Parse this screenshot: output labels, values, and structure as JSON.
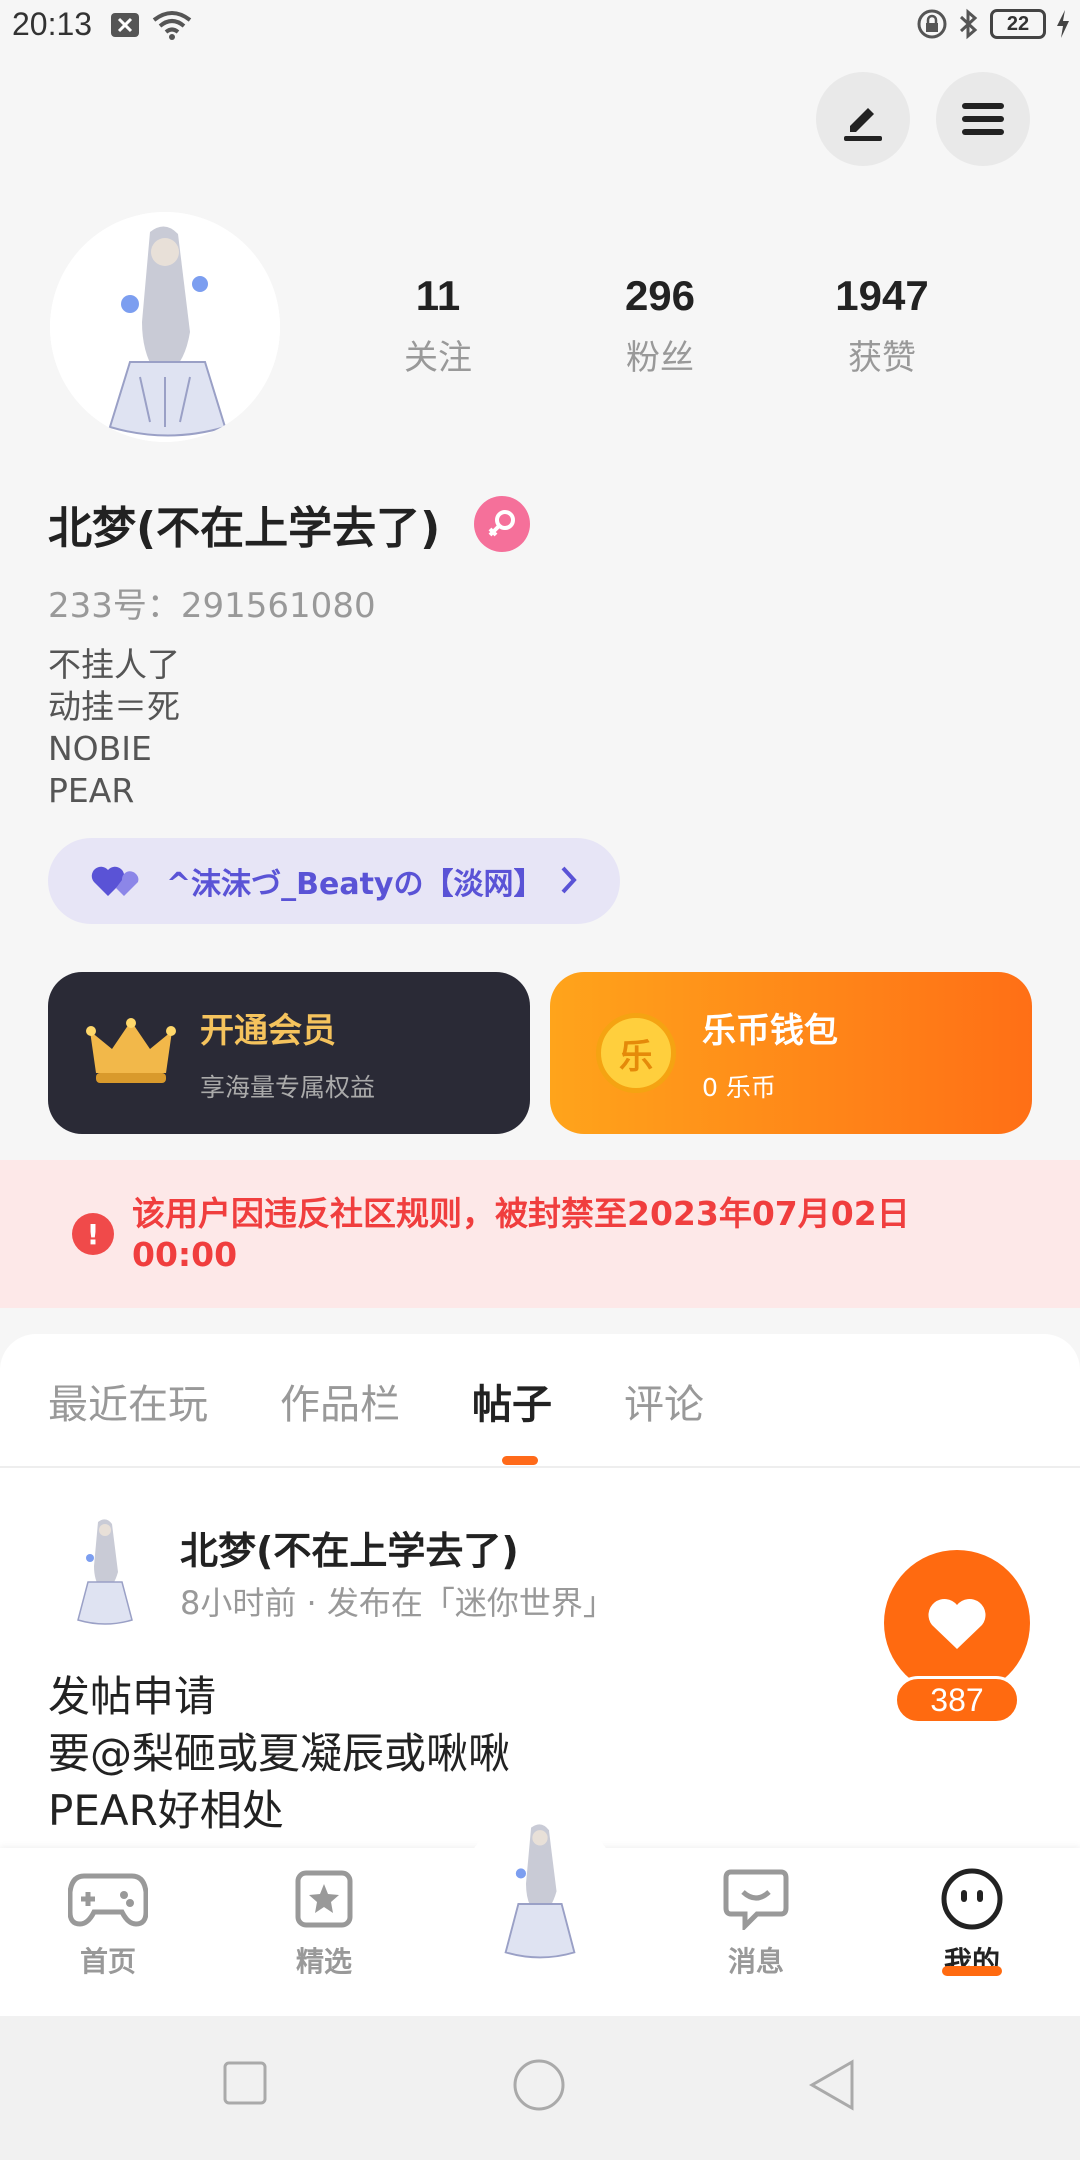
{
  "status_bar": {
    "time": "20:13",
    "battery": "22"
  },
  "profile": {
    "stats": [
      {
        "value": "11",
        "label": "关注"
      },
      {
        "value": "296",
        "label": "粉丝"
      },
      {
        "value": "1947",
        "label": "获赞"
      }
    ],
    "username": "北梦(不在上学去了)",
    "user_id": "233号：291561080",
    "bio": [
      "不挂人了",
      "动挂＝死",
      "NOBIE",
      "PEAR"
    ],
    "fan_chip": "^沫沫づ_Beatyの【淡网】"
  },
  "cards": {
    "vip": {
      "title": "开通会员",
      "subtitle": "享海量专属权益"
    },
    "wallet": {
      "title": "乐币钱包",
      "subtitle": "0 乐币",
      "coin_glyph": "乐"
    }
  },
  "ban_notice": "该用户因违反社区规则，被封禁至2023年07月02日 00:00",
  "tabs": [
    {
      "label": "最近在玩",
      "active": false
    },
    {
      "label": "作品栏",
      "active": false
    },
    {
      "label": "帖子",
      "active": true
    },
    {
      "label": "评论",
      "active": false
    }
  ],
  "post": {
    "author": "北梦(不在上学去了)",
    "meta": "8小时前 · 发布在「迷你世界」",
    "body": [
      "发帖申请",
      "要@梨砸或夏凝辰或啾啾",
      "PEAR好相处"
    ],
    "likes": "387"
  },
  "bottom_nav": [
    {
      "label": "首页",
      "icon": "gamepad-icon"
    },
    {
      "label": "精选",
      "icon": "star-bookmark-icon"
    },
    {
      "label": "消息",
      "icon": "chat-bubble-icon"
    },
    {
      "label": "我的",
      "icon": "smiley-face-icon"
    }
  ],
  "colors": {
    "accent": "#ff6a10",
    "ban": "#f03e3e",
    "fan_chip": "#5a53d6"
  }
}
